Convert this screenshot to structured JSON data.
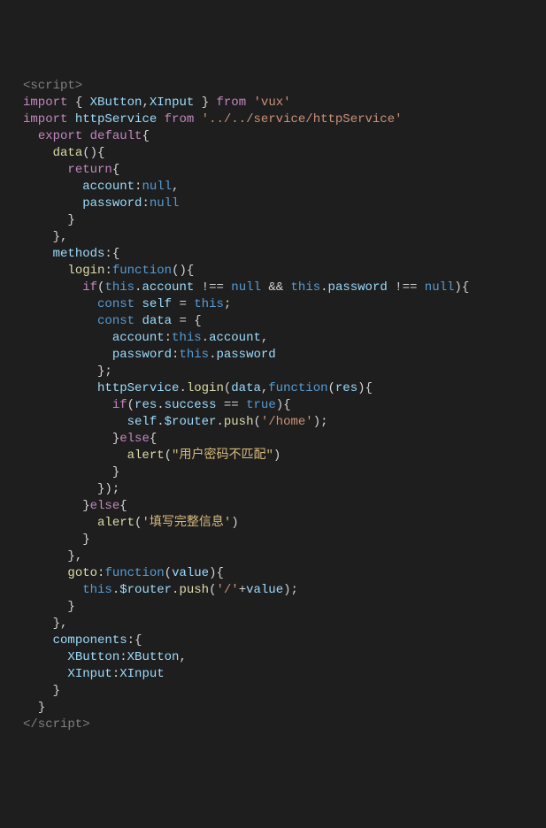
{
  "tokens": {
    "tag_open": "<script>",
    "tag_close": "</script>",
    "kw_import": "import",
    "kw_from": "from",
    "kw_export": "export",
    "kw_default": "default",
    "kw_return": "return",
    "kw_if": "if",
    "kw_else": "else",
    "kw_const": "const",
    "kw_function": "function",
    "kw_this": "this",
    "kw_null": "null",
    "kw_true": "true",
    "id_XButton": "XButton",
    "id_XInput": "XInput",
    "id_httpService": "httpService",
    "id_data": "data",
    "id_account": "account",
    "id_password": "password",
    "id_methods": "methods",
    "id_login": "login",
    "id_self": "self",
    "id_success": "success",
    "id_$router": "$router",
    "id_push": "push",
    "id_res": "res",
    "id_goto": "goto",
    "id_value": "value",
    "id_components": "components",
    "id_alert": "alert",
    "str_vux": "'vux'",
    "str_httpService": "'../../service/httpService'",
    "str_home": "'/home'",
    "str_slash": "'/'",
    "str_alert1": "\"用户密码不匹配\"",
    "str_alert2": "'填写完整信息'",
    "op_eqeq": "==",
    "op_neq": "!==",
    "op_and": "&&",
    "op_assign": "=",
    "brace_open": "{",
    "brace_close": "}",
    "paren_open": "(",
    "paren_close": ")",
    "comma": ",",
    "colon": ":",
    "semi": ";",
    "dot": ".",
    "plus": "+"
  }
}
